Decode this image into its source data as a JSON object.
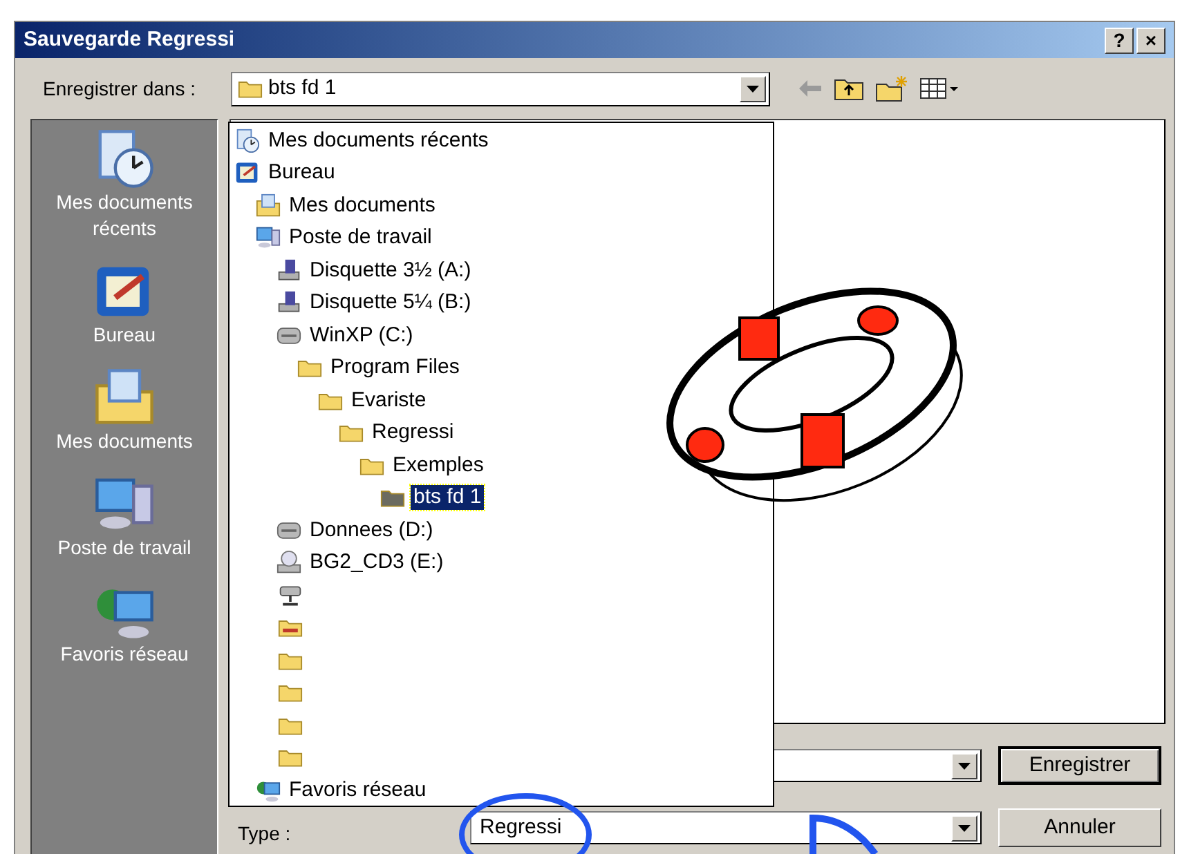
{
  "window": {
    "title": "Sauvegarde Regressi",
    "title_buttons": [
      "?",
      "×"
    ]
  },
  "save_in": {
    "label": "Enregistrer dans :",
    "value": "bts fd 1"
  },
  "places": [
    {
      "label": "Mes documents récents",
      "kind": "recent"
    },
    {
      "label": "Bureau",
      "kind": "desktop"
    },
    {
      "label": "Mes documents",
      "kind": "documents"
    },
    {
      "label": "Poste de travail",
      "kind": "computer"
    },
    {
      "label": "Favoris réseau",
      "kind": "network"
    }
  ],
  "location_list": [
    {
      "label": "Mes documents récents",
      "kind": "recent",
      "selected": false
    },
    {
      "label": "Bureau",
      "kind": "desktop",
      "selected": false,
      "children": [
        {
          "label": "Mes documents",
          "kind": "documents",
          "selected": false
        },
        {
          "label": "Poste de travail",
          "kind": "computer",
          "selected": false,
          "children": [
            {
              "label": "Disquette 3½ (A:)",
              "kind": "floppy",
              "selected": false
            },
            {
              "label": "Disquette 5¼ (B:)",
              "kind": "floppy",
              "selected": false
            },
            {
              "label": "WinXP (C:)",
              "kind": "drive",
              "selected": false,
              "children": [
                {
                  "label": "Program Files",
                  "kind": "folder",
                  "selected": false,
                  "children": [
                    {
                      "label": "Evariste",
                      "kind": "folder",
                      "selected": false,
                      "children": [
                        {
                          "label": "Regressi",
                          "kind": "folder",
                          "selected": false,
                          "children": [
                            {
                              "label": "Exemples",
                              "kind": "folder",
                              "selected": false,
                              "children": [
                                {
                                  "label": "bts fd 1",
                                  "kind": "open_folder",
                                  "selected": true
                                }
                              ]
                            }
                          ]
                        }
                      ]
                    }
                  ]
                }
              ]
            },
            {
              "label": "Donnees (D:)",
              "kind": "drive",
              "selected": false
            },
            {
              "label": "BG2_CD3 (E:)",
              "kind": "cdrom",
              "selected": false
            },
            {
              "kind": "network_drive",
              "selected": false
            },
            {
              "kind": "drive_folder",
              "selected": false
            },
            {
              "kind": "folder",
              "selected": false
            },
            {
              "kind": "folder",
              "selected": false
            },
            {
              "kind": "folder",
              "selected": false
            },
            {
              "kind": "folder",
              "selected": false
            }
          ]
        },
        {
          "label": "Favoris réseau",
          "kind": "network",
          "selected": false
        }
      ]
    }
  ],
  "file_type": {
    "label": "Type :",
    "value": "Regressi"
  },
  "buttons": [
    "Enregistrer",
    "Annuler"
  ]
}
